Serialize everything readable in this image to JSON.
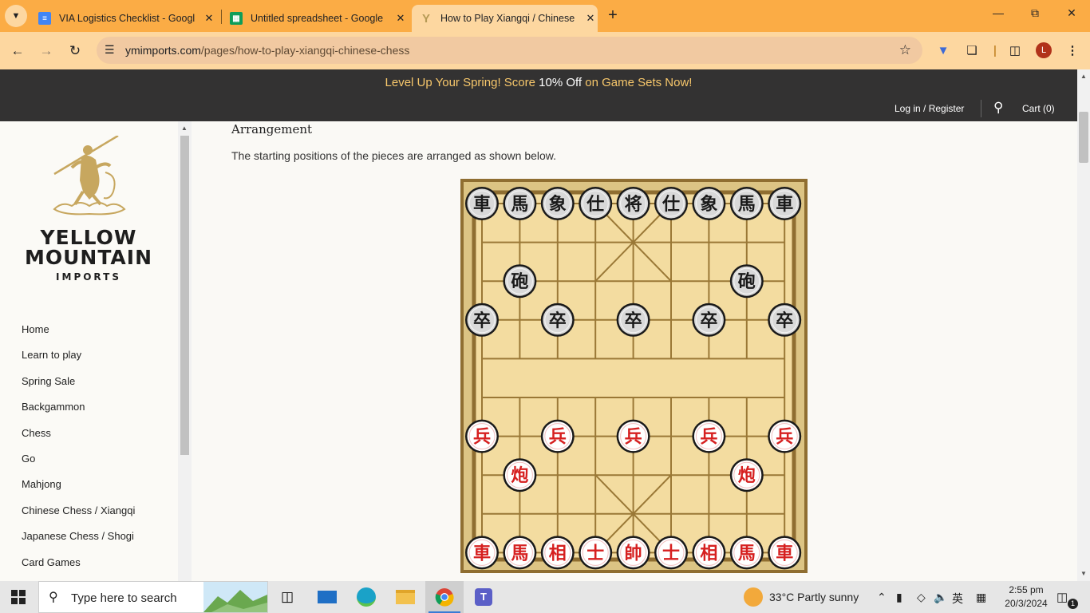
{
  "browser": {
    "tabs": [
      {
        "title": "VIA Logistics Checklist - Google",
        "icon": "google-docs-icon",
        "color": "#4285f4"
      },
      {
        "title": "Untitled spreadsheet - Google S",
        "icon": "google-sheets-icon",
        "color": "#0f9d58"
      },
      {
        "title": "How to Play Xiangqi / Chinese C",
        "icon": "yellow-mountain-favicon",
        "color": "#c7b377",
        "active": true
      }
    ],
    "url_domain": "ymimports.com",
    "url_path": "/pages/how-to-play-xiangqi-chinese-chess",
    "profile_initial": "L",
    "tab_color": "#fbac45",
    "toolbar_color": "#fdd7a0"
  },
  "promo": {
    "before": "Level Up Your Spring! Score ",
    "highlight": "10% Off",
    "after": " on Game Sets Now!"
  },
  "header": {
    "login": "Log in / Register",
    "cart": "Cart (0)"
  },
  "logo": {
    "line1": "YELLOW",
    "line2": "MOUNTAIN",
    "line3": "IMPORTS"
  },
  "sidebar": {
    "items": [
      "Home",
      "Learn to play",
      "Spring Sale",
      "Backgammon",
      "Chess",
      "Go",
      "Mahjong",
      "Chinese Chess / Xiangqi",
      "Japanese Chess / Shogi",
      "Card Games"
    ]
  },
  "main": {
    "section_title": "Arrangement",
    "intro": "The starting positions of the pieces are arranged as shown below."
  },
  "board": {
    "black_back": [
      "車",
      "馬",
      "象",
      "仕",
      "将",
      "仕",
      "象",
      "馬",
      "車"
    ],
    "black_cannon": "砲",
    "black_soldier": "卒",
    "red_back": [
      "車",
      "馬",
      "相",
      "士",
      "帥",
      "士",
      "相",
      "馬",
      "車"
    ],
    "red_cannon": "炮",
    "red_soldier": "兵",
    "red_color": "#d62020",
    "black_color": "#1a1a1a"
  },
  "taskbar": {
    "search_placeholder": "Type here to search",
    "weather": "33°C  Partly sunny",
    "ime": "英",
    "time": "2:55 pm",
    "date": "20/3/2024",
    "notifications": "1"
  }
}
